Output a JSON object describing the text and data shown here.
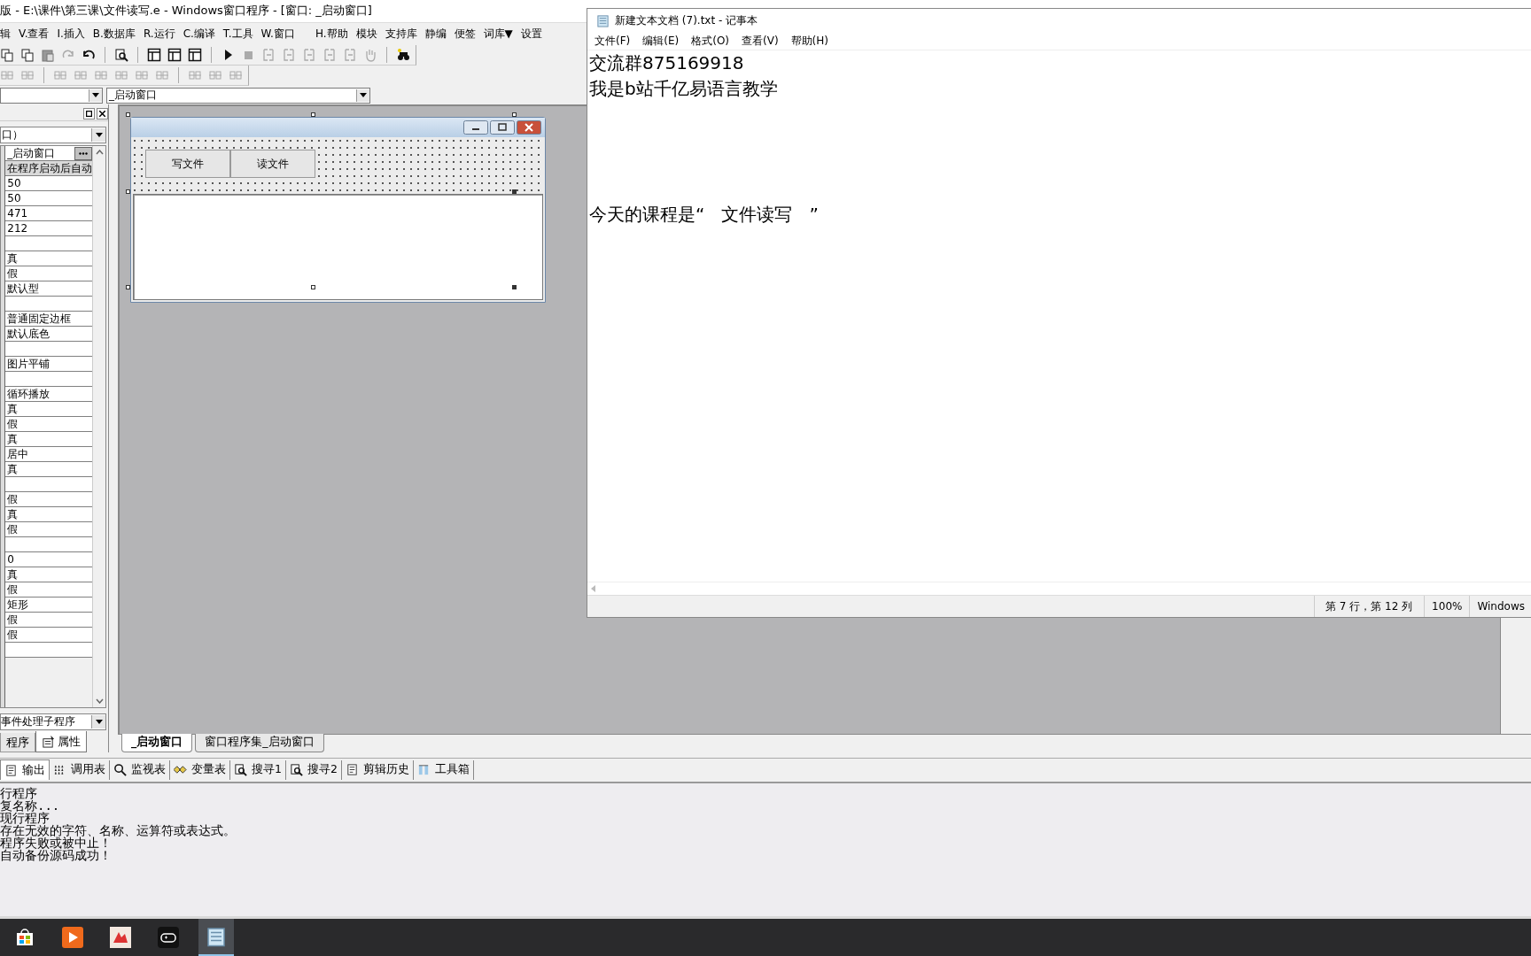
{
  "ide": {
    "title": "版 - E:\\课件\\第三课\\文件读写.e - Windows窗口程序 - [窗口: _启动窗口]",
    "menu": [
      "辑",
      "V.查看",
      "I.插入",
      "B.数据库",
      "R.运行",
      "C.编译",
      "T.工具",
      "W.窗口",
      "H.帮助",
      "模块",
      "支持库",
      "静编",
      "便签",
      "词库▼",
      "设置"
    ],
    "object_combo": "_启动窗口",
    "properties": {
      "object": "口）",
      "rows": [
        {
          "kind": "picker",
          "value": "_启动窗口",
          "selected": false
        },
        {
          "kind": "value",
          "value": "在程序启动后自动",
          "selected": true
        },
        {
          "kind": "value",
          "value": "50",
          "selected": false
        },
        {
          "kind": "value",
          "value": "50",
          "selected": false
        },
        {
          "kind": "value",
          "value": "471",
          "selected": false
        },
        {
          "kind": "value",
          "value": "212",
          "selected": false
        },
        {
          "kind": "blank",
          "selected": false
        },
        {
          "kind": "value",
          "value": "真",
          "selected": false
        },
        {
          "kind": "value",
          "value": "假",
          "selected": false
        },
        {
          "kind": "value",
          "value": "默认型",
          "selected": false
        },
        {
          "kind": "blank",
          "selected": false
        },
        {
          "kind": "value",
          "value": "普通固定边框",
          "selected": false
        },
        {
          "kind": "value",
          "value": "默认底色",
          "selected": false
        },
        {
          "kind": "blank",
          "selected": false
        },
        {
          "kind": "value",
          "value": "图片平铺",
          "selected": false
        },
        {
          "kind": "blank",
          "selected": false
        },
        {
          "kind": "value",
          "value": "循环播放",
          "selected": false
        },
        {
          "kind": "value",
          "value": "真",
          "selected": false
        },
        {
          "kind": "value",
          "value": "假",
          "selected": false
        },
        {
          "kind": "value",
          "value": "真",
          "selected": false
        },
        {
          "kind": "value",
          "value": "居中",
          "selected": false
        },
        {
          "kind": "value",
          "value": "真",
          "selected": false
        },
        {
          "kind": "blank",
          "selected": false
        },
        {
          "kind": "value",
          "value": "假",
          "selected": false
        },
        {
          "kind": "value",
          "value": "真",
          "selected": false
        },
        {
          "kind": "value",
          "value": "假",
          "selected": false
        },
        {
          "kind": "blank",
          "selected": false
        },
        {
          "kind": "value",
          "value": "0",
          "selected": false
        },
        {
          "kind": "value",
          "value": "真",
          "selected": false
        },
        {
          "kind": "value",
          "value": "假",
          "selected": false
        },
        {
          "kind": "value",
          "value": "矩形",
          "selected": false
        },
        {
          "kind": "value",
          "value": "假",
          "selected": false
        },
        {
          "kind": "value",
          "value": "假",
          "selected": false
        },
        {
          "kind": "blank",
          "selected": false
        }
      ],
      "event_combo": "事件处理子程序",
      "tabs": [
        {
          "label": "程序",
          "selected": false
        },
        {
          "label": "属性",
          "selected": true
        }
      ]
    },
    "form_buttons": [
      "写文件",
      "读文件"
    ],
    "editor_tabs": [
      {
        "label": "_启动窗口",
        "selected": true
      },
      {
        "label": "窗口程序集_启动窗口",
        "selected": false
      }
    ],
    "output_tabs": [
      {
        "label": "输出",
        "selected": true
      },
      {
        "label": "调用表",
        "selected": false
      },
      {
        "label": "监视表",
        "selected": false
      },
      {
        "label": "变量表",
        "selected": false
      },
      {
        "label": "搜寻1",
        "selected": false
      },
      {
        "label": "搜寻2",
        "selected": false
      },
      {
        "label": "剪辑历史",
        "selected": false
      },
      {
        "label": "工具箱",
        "selected": false
      }
    ],
    "output_lines": [
      "行程序",
      "复名称...",
      "现行程序",
      "存在无效的字符、名称、运算符或表达式。",
      "程序失败或被中止！",
      "自动备份源码成功！"
    ]
  },
  "notepad": {
    "title": "新建文本文档 (7).txt - 记事本",
    "menu": [
      "文件(F)",
      "编辑(E)",
      "格式(O)",
      "查看(V)",
      "帮助(H)"
    ],
    "lines": [
      "交流群875169918",
      "我是b站千亿易语言教学",
      "今天的课程是“   文件读写   ”"
    ],
    "status": [
      "第 7 行，第 12 列",
      "100%",
      "Windows"
    ]
  }
}
